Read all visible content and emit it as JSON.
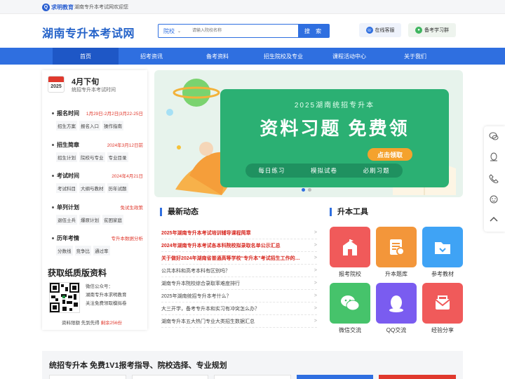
{
  "topbar": {
    "logo_text": "求明教育",
    "welcome": "湖南专升本考试网欢迎您"
  },
  "header": {
    "site_title": "湖南专升本考试网",
    "search": {
      "select_value": "院校",
      "placeholder": "请输入院校名称",
      "button": "搜 索"
    },
    "service_label": "在线客服",
    "group_label": "备考学习群"
  },
  "nav": [
    "首页",
    "招考资讯",
    "备考资料",
    "招生院校及专业",
    "课程活动中心",
    "关于我们"
  ],
  "left": {
    "calendar_year": "2025",
    "time_title": "4月下旬",
    "time_sub": "统招专升本考试时间",
    "sections": [
      {
        "title": "报名时间",
        "note": "1月29日-2月2日|3月22-25日",
        "links": [
          "招生方案",
          "报名入口",
          "操作指南"
        ]
      },
      {
        "title": "招生简章",
        "note": "2024年3月12日前",
        "links": [
          "招生计划",
          "院校与专业",
          "专业目录"
        ]
      },
      {
        "title": "考试时间",
        "note": "2024年4月21日",
        "links": [
          "考试科目",
          "大纲与教材",
          "历年试题"
        ]
      },
      {
        "title": "单列计划",
        "note": "免试生政策",
        "links": [
          "退伍士兵",
          "爆原计划",
          "贫困家庭"
        ]
      },
      {
        "title": "历年考情",
        "note": "专升本数据分析",
        "links": [
          "分数线",
          "竞争比",
          "通过率"
        ]
      }
    ],
    "paper_title": "获取纸质版资料",
    "qr_lines": [
      "微信公众号：",
      "湖南专升本求明教育",
      "关注免费领取模拟卷"
    ],
    "qr_bottom_prefix": "资料限额 先到先得",
    "qr_bottom_red": "剩余256份"
  },
  "banner": {
    "subtitle": "2025湖南统招专升本",
    "headline": "资料习题 免费领",
    "cta": "点击领取",
    "tags": [
      "每日练习",
      "模拟试卷",
      "必刷习题"
    ]
  },
  "news": {
    "title": "最新动态",
    "items": [
      {
        "text": "2025年湖南专升本考试培训辅导课程简章",
        "hot": true
      },
      {
        "text": "2024年湖南专升本考试各本科院校拟录取名单公示汇总",
        "hot": true
      },
      {
        "text": "关于做好2024年湖南省普通高等学校“专升本”考试招生工作的通知",
        "hot": true
      },
      {
        "text": "公共本科和高考本科有区别吗？",
        "hot": false
      },
      {
        "text": "湖南专升本院校综合录取率难度排行",
        "hot": false
      },
      {
        "text": "2025年湖南统招专升本考什么？",
        "hot": false
      },
      {
        "text": "大三开学，备考专升本和实习有冲突怎么办？",
        "hot": false
      },
      {
        "text": "湖南专升本五大热门专业大类招生数据汇总",
        "hot": false
      }
    ],
    "arrow": ">"
  },
  "tools": {
    "title": "升本工具",
    "items": [
      {
        "label": "报考院校",
        "color": "#f05a5a"
      },
      {
        "label": "升本题库",
        "color": "#f3963a"
      },
      {
        "label": "参考教材",
        "color": "#3fa3f5"
      },
      {
        "label": "微信交流",
        "color": "#46c36b"
      },
      {
        "label": "QQ交流",
        "color": "#7a5cf0"
      },
      {
        "label": "经验分享",
        "color": "#f05a5a"
      }
    ]
  },
  "bottom": {
    "title": "统招专升本 免费1V1报考指导、院校选择、专业规划"
  }
}
